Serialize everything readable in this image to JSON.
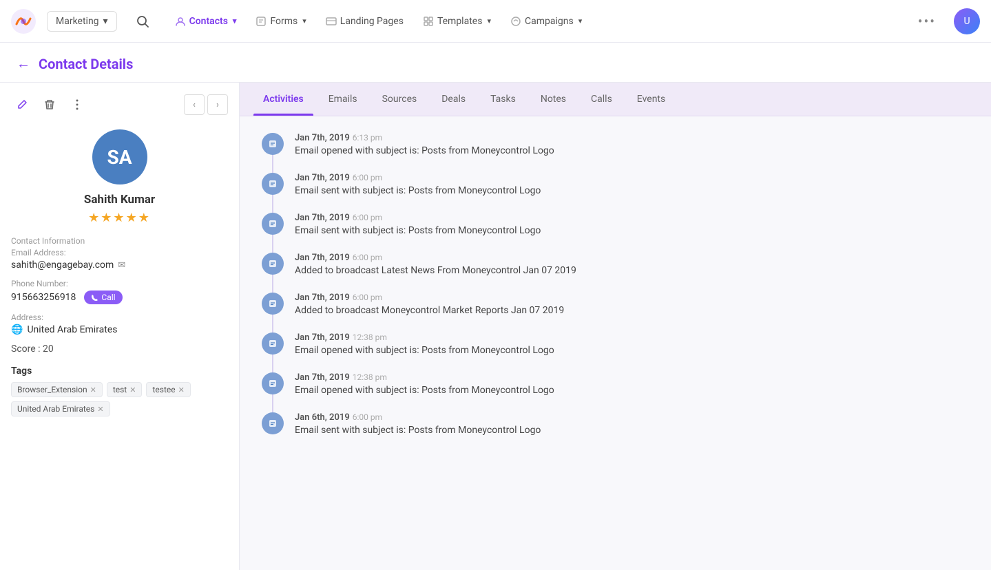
{
  "app": {
    "logo_text": "🚀",
    "workspace": "Marketing",
    "workspace_chevron": "▾"
  },
  "nav": {
    "items": [
      {
        "id": "contacts",
        "label": "Contacts",
        "active": true,
        "icon": "contact-icon"
      },
      {
        "id": "forms",
        "label": "Forms",
        "active": false,
        "icon": "forms-icon"
      },
      {
        "id": "landing-pages",
        "label": "Landing Pages",
        "active": false,
        "icon": "landing-icon"
      },
      {
        "id": "templates",
        "label": "Templates",
        "active": false,
        "icon": "templates-icon"
      },
      {
        "id": "campaigns",
        "label": "Campaigns",
        "active": false,
        "icon": "campaigns-icon"
      }
    ],
    "more_label": "•••"
  },
  "page": {
    "back_label": "←",
    "title": "Contact Details"
  },
  "sidebar": {
    "edit_icon": "✏️",
    "delete_icon": "🗑",
    "more_icon": "⋮",
    "prev_label": "‹",
    "next_label": "›",
    "avatar_initials": "SA",
    "contact_name": "Sahith Kumar",
    "stars": "★★★★★",
    "contact_info_label": "Contact Information",
    "email_label": "Email Address:",
    "email_value": "sahith@engagebay.com",
    "phone_label": "Phone Number:",
    "phone_value": "915663256918",
    "call_button": "Call",
    "address_label": "Address:",
    "address_value": "United Arab Emirates",
    "score_label": "Score : 20",
    "tags_label": "Tags",
    "tags": [
      {
        "label": "Browser_Extension",
        "removable": true
      },
      {
        "label": "test",
        "removable": true
      },
      {
        "label": "testee",
        "removable": true
      },
      {
        "label": "United Arab Emirates",
        "removable": true
      }
    ]
  },
  "tabs": [
    {
      "id": "activities",
      "label": "Activities",
      "active": true
    },
    {
      "id": "emails",
      "label": "Emails",
      "active": false
    },
    {
      "id": "sources",
      "label": "Sources",
      "active": false
    },
    {
      "id": "deals",
      "label": "Deals",
      "active": false
    },
    {
      "id": "tasks",
      "label": "Tasks",
      "active": false
    },
    {
      "id": "notes",
      "label": "Notes",
      "active": false
    },
    {
      "id": "calls",
      "label": "Calls",
      "active": false
    },
    {
      "id": "events",
      "label": "Events",
      "active": false
    }
  ],
  "activities": [
    {
      "date": "Jan 7th, 2019",
      "time": "6:13 pm",
      "text": "Email opened with subject is: Posts from Moneycontrol Logo"
    },
    {
      "date": "Jan 7th, 2019",
      "time": "6:00 pm",
      "text": "Email sent with subject is: Posts from Moneycontrol Logo"
    },
    {
      "date": "Jan 7th, 2019",
      "time": "6:00 pm",
      "text": "Email sent with subject is: Posts from Moneycontrol Logo"
    },
    {
      "date": "Jan 7th, 2019",
      "time": "6:00 pm",
      "text": "Added to broadcast Latest News From Moneycontrol Jan 07 2019"
    },
    {
      "date": "Jan 7th, 2019",
      "time": "6:00 pm",
      "text": "Added to broadcast Moneycontrol Market Reports Jan 07 2019"
    },
    {
      "date": "Jan 7th, 2019",
      "time": "12:38 pm",
      "text": "Email opened with subject is: Posts from Moneycontrol Logo"
    },
    {
      "date": "Jan 7th, 2019",
      "time": "12:38 pm",
      "text": "Email opened with subject is: Posts from Moneycontrol Logo"
    },
    {
      "date": "Jan 6th, 2019",
      "time": "6:00 pm",
      "text": "Email sent with subject is: Posts from Moneycontrol Logo"
    }
  ]
}
